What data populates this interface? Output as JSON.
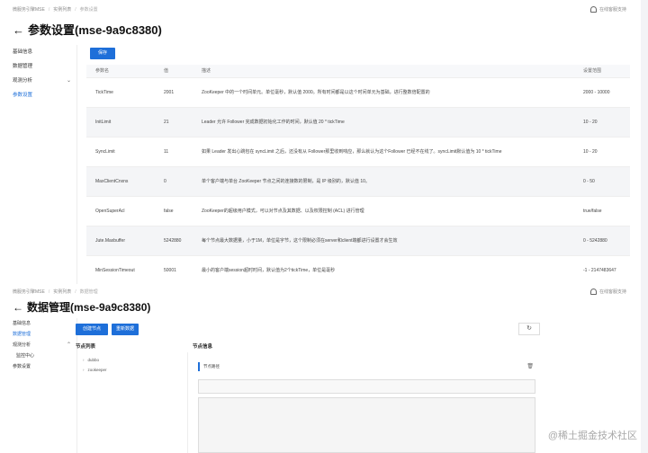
{
  "top": {
    "breadcrumb": [
      "微服务引擎MSE",
      "实例列表",
      "参数设置"
    ],
    "help_label": "在线客服支持",
    "title": "参数设置(mse-9a9c8380)",
    "sidebar": [
      "基础信息",
      "数据管理",
      "观测分析",
      "参数设置"
    ],
    "save_label": "保存",
    "table": {
      "headers": [
        "参数名",
        "值",
        "描述",
        "设置范围"
      ],
      "rows": [
        [
          "TickTime",
          "2001",
          "ZooKeeper 中的一个时间单元。单位毫秒，默认值 2000。所有时间都是以这个时间单元为基础，进行整数倍配置的",
          "2000 - 10000"
        ],
        [
          "InitLimit",
          "21",
          "Leader 允许 Follower 完成数据初始化工作的时间，默认值 20 * tickTime",
          "10 - 20"
        ],
        [
          "SyncLimit",
          "11",
          "如果 Leader 发出心跳包在 syncLimit 之后，还没有从 Follower那里收到响应，那么就认为这个Follower 已经不在线了。syncLimit默认值为 10 * tickTime",
          "10 - 20"
        ],
        [
          "MaxClientCnxns",
          "0",
          "单个客户端与单台 ZooKeeper 节点之间的连接数的限制，是 IP 级别的，默认值 10。",
          "0 - 50"
        ],
        [
          "OpenSuperAcl",
          "false",
          "ZooKeeper的超级用户模式，可以对节点及其数据、以及权限控制 (ACL) 进行管理",
          "true/false"
        ],
        [
          "Jute.Maxbuffer",
          "5242880",
          "每个节点最大数据量，小于1M，单位是字节，这个限制必须在server和client端都进行设置才会生效",
          "0 - 5242880"
        ],
        [
          "MinSessionTimeout",
          "50001",
          "最小的客户端session超时时间，默认值为2个tickTime，单位是毫秒",
          "-1 - 2147483647"
        ]
      ]
    }
  },
  "bottom": {
    "breadcrumb": [
      "微服务引擎MSE",
      "实例列表",
      "数据管理"
    ],
    "help_label": "在线客服支持",
    "title": "数据管理(mse-9a9c8380)",
    "sidebar": [
      "基础信息",
      "数据管理",
      "观测分析",
      "监控中心",
      "参数设置"
    ],
    "create_label": "创建节点",
    "refresh_label": "重新数据",
    "refresh_icon": "↻",
    "tree_title": "节点列表",
    "info_title": "节点信息",
    "tree": [
      "dubbo",
      "zookeeper"
    ],
    "path_label": "节点路径"
  },
  "watermark": "@稀土掘金技术社区",
  "colors": {
    "primary": "#1e6fd9"
  }
}
